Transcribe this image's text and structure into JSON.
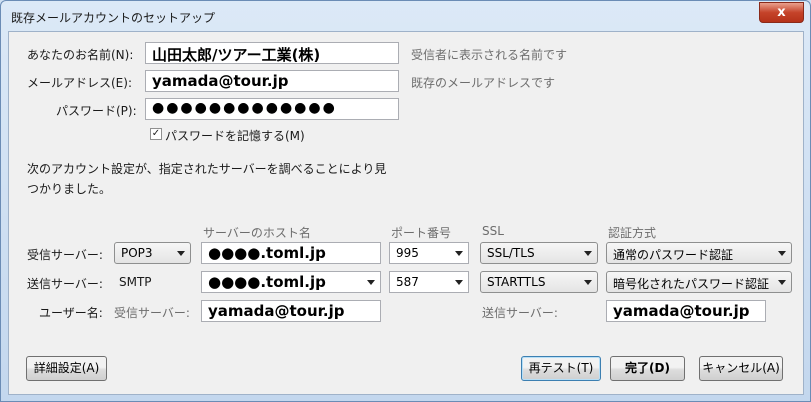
{
  "window": {
    "title": "既存メールアカウントのセットアップ",
    "close_glyph": "x"
  },
  "identity": {
    "name_label": "あなたのお名前(N):",
    "name_value": "山田太郎/ツアー工業(株)",
    "name_hint": "受信者に表示される名前です",
    "email_label": "メールアドレス(E):",
    "email_value": "yamada@tour.jp",
    "email_hint": "既存のメールアドレスです",
    "password_label": "パスワード(P):",
    "password_value": "●●●●●●●●●●●●●",
    "remember_label": "パスワードを記憶する(M)",
    "remember_checked": "✓"
  },
  "message": {
    "line1": "次のアカウント設定が、指定されたサーバーを調べることにより見",
    "line2": "つかりました。"
  },
  "columns": {
    "host": "サーバーのホスト名",
    "port": "ポート番号",
    "ssl": "SSL",
    "auth": "認証方式"
  },
  "incoming": {
    "label": "受信サーバー:",
    "protocol": "POP3",
    "host": "●●●●.toml.jp",
    "port": "995",
    "ssl": "SSL/TLS",
    "auth": "通常のパスワード認証"
  },
  "outgoing": {
    "label": "送信サーバー:",
    "protocol": "SMTP",
    "host": "●●●●.toml.jp",
    "port": "587",
    "ssl": "STARTTLS",
    "auth": "暗号化されたパスワード認証"
  },
  "username": {
    "label": "ユーザー名:",
    "incoming_label": "受信サーバー:",
    "incoming_value": "yamada@tour.jp",
    "outgoing_label": "送信サーバー:",
    "outgoing_value": "yamada@tour.jp"
  },
  "buttons": {
    "advanced": "詳細設定(A)",
    "retest": "再テスト(T)",
    "done": "完了(D)",
    "cancel": "キャンセル(A)"
  }
}
